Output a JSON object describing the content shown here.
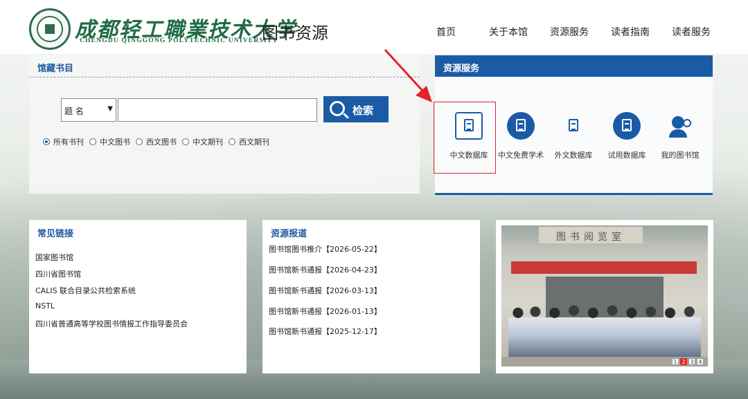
{
  "header": {
    "logo_cn": "成都轻工職業技术大学",
    "logo_en": "CHENGDU QINGGONG POLYTECHNIC UNIVERSITY",
    "site_title": "图书资源",
    "nav": [
      "首页",
      "关于本馆",
      "资源服务",
      "读者指南",
      "读者服务"
    ]
  },
  "catalog": {
    "title": "馆藏书目",
    "select_value": "题 名",
    "search_placeholder": "",
    "search_button": "检索",
    "radios": [
      {
        "label": "所有书刊",
        "checked": true
      },
      {
        "label": "中文图书",
        "checked": false
      },
      {
        "label": "西文图书",
        "checked": false
      },
      {
        "label": "中文期刊",
        "checked": false
      },
      {
        "label": "西文期刊",
        "checked": false
      }
    ]
  },
  "resources": {
    "title": "资源服务",
    "items": [
      {
        "label": "中文数据库",
        "icon": "database-icon"
      },
      {
        "label": "中文免费学术",
        "icon": "clipboard-icon"
      },
      {
        "label": "外文数据库",
        "icon": "document-icon"
      },
      {
        "label": "试用数据库",
        "icon": "clipboard-icon"
      },
      {
        "label": "我的图书馆",
        "icon": "users-icon"
      }
    ]
  },
  "links": {
    "title": "常见链接",
    "items": [
      "国家图书馆",
      "四川省图书馆",
      "CALIS 联合目录公共检索系统",
      "NSTL",
      "四川省普通高等学校图书情报工作指导委员会"
    ]
  },
  "news": {
    "title": "资源报道",
    "items": [
      "图书馆图书推介【2026-05-22】",
      "图书馆新书通报【2026-04-23】",
      "图书馆新书通报【2026-03-13】",
      "图书馆新书通报【2026-01-13】",
      "图书馆新书通报【2025-12-17】"
    ]
  },
  "photo": {
    "sign": "图书阅览室",
    "pages": [
      "1",
      "2",
      "3",
      "4"
    ],
    "active_page": "2"
  },
  "colors": {
    "brand_blue": "#1b5ba6",
    "logo_green": "#1f6b45",
    "highlight_red": "#e2232a"
  }
}
